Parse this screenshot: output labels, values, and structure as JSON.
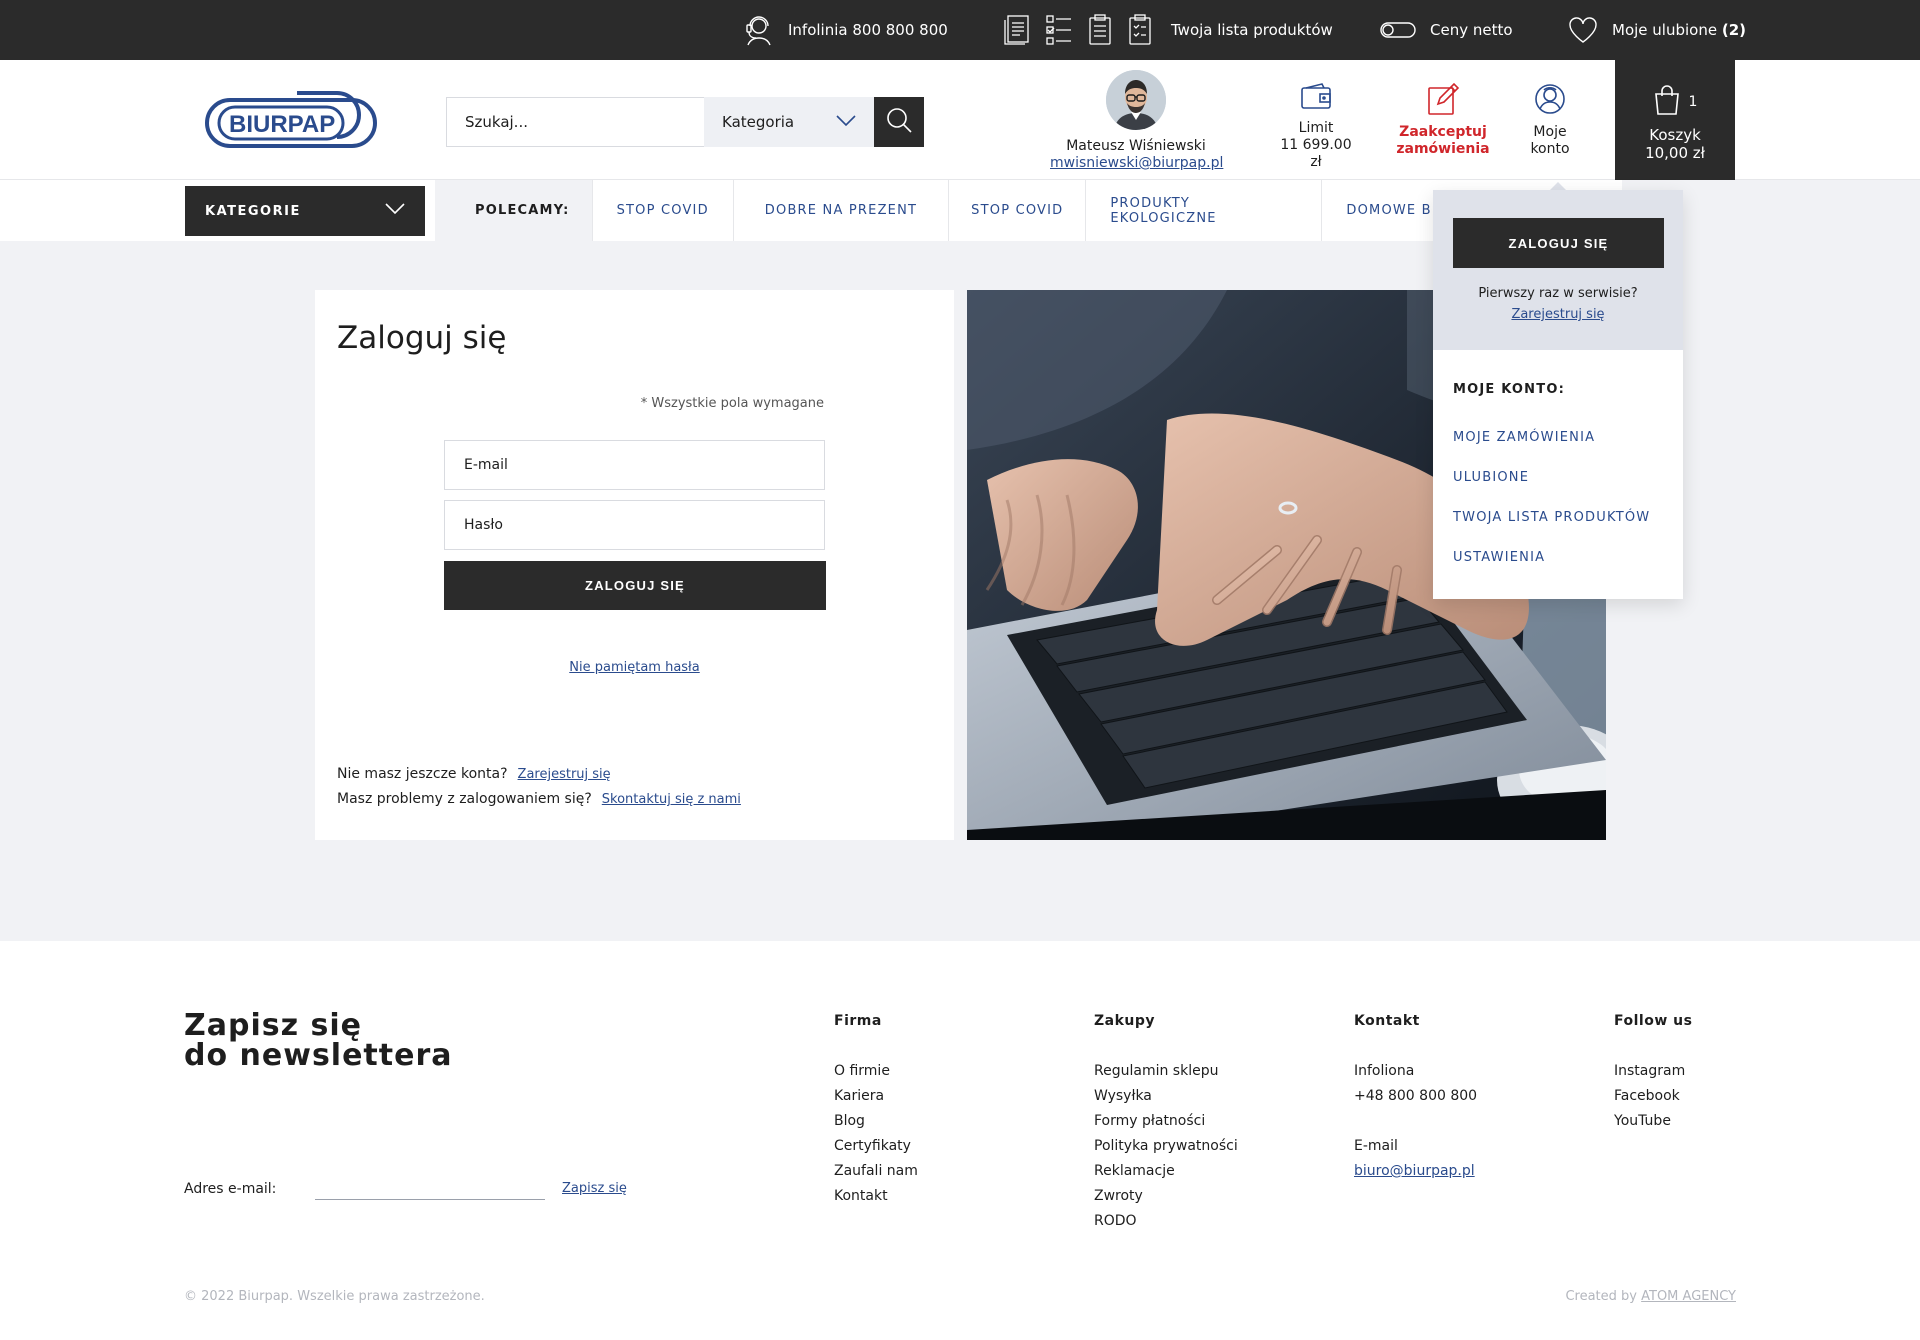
{
  "top_bar": {
    "hotline": "Infolinia 800 800 800",
    "product_list": "Twoja lista produktów",
    "net_prices": "Ceny netto",
    "favorites_label": "Moje ulubione",
    "favorites_count": "(2)"
  },
  "header": {
    "logo_text": "BIURPAP",
    "search_placeholder": "Szukaj...",
    "category_select": "Kategoria",
    "user_name": "Mateusz Wiśniewski",
    "user_email": "mwisniewski@biurpap.pl",
    "limit_label": "Limit",
    "limit_value": "11 699.00 zł",
    "accept_line1": "Zaakceptuj",
    "accept_line2": "zamówienia",
    "account_line1": "Moje",
    "account_line2": "konto",
    "cart_count": "1",
    "cart_label": "Koszyk",
    "cart_total": "10,00 zł"
  },
  "nav": {
    "categories_button": "KATEGORIE",
    "recommend_label": "POLECAMY:",
    "links": [
      "STOP COVID",
      "DOBRE NA PREZENT",
      "STOP COVID",
      "PRODUKTY EKOLOGICZNE",
      "DOMOWE BIURO"
    ]
  },
  "login": {
    "title": "Zaloguj się",
    "required_note": "* Wszystkie pola wymagane",
    "email_placeholder": "E-mail",
    "password_placeholder": "Hasło",
    "submit": "ZALOGUJ SIĘ",
    "forgot": "Nie pamiętam hasła",
    "no_account": "Nie masz jeszcze konta?",
    "register": "Zarejestruj się",
    "problems": "Masz problemy z zalogowaniem się?",
    "contact": "Skontaktuj się z nami"
  },
  "dropdown": {
    "login_button": "ZALOGUJ SIĘ",
    "first_time": "Pierwszy raz w serwisie?",
    "register": "Zarejestruj się",
    "account_heading": "MOJE KONTO:",
    "links": [
      "MOJE ZAMÓWIENIA",
      "ULUBIONE",
      "TWOJA LISTA PRODUKTÓW",
      "USTAWIENIA"
    ]
  },
  "footer": {
    "newsletter_line1": "Zapisz się",
    "newsletter_line2": "do newslettera",
    "email_label": "Adres e-mail:",
    "subscribe": "Zapisz się",
    "columns": [
      {
        "title": "Firma",
        "links": [
          "O firmie",
          "Kariera",
          "Blog",
          "Certyfikaty",
          "Zaufali nam",
          "Kontakt"
        ]
      },
      {
        "title": "Zakupy",
        "links": [
          "Regulamin sklepu",
          "Wysyłka",
          "Formy płatności",
          "Polityka prywatności",
          "Reklamacje",
          "Zwroty",
          "RODO"
        ]
      },
      {
        "title": "Kontakt",
        "phone_label": "Infoliona",
        "phone": "+48 800 800 800",
        "email_label": "E-mail",
        "email": "biuro@biurpap.pl"
      },
      {
        "title": "Follow us",
        "links": [
          "Instagram",
          "Facebook",
          "YouTube"
        ]
      }
    ],
    "copyright": "© 2022 Biurpap. Wszelkie prawa zastrzeżone.",
    "created_by": "Created by",
    "agency": "ATOM AGENCY"
  },
  "colors": {
    "dark": "#2b2b2b",
    "accent_blue": "#2a4b8d",
    "accent_red": "#d0262b",
    "light_bg": "#f1f2f5"
  }
}
